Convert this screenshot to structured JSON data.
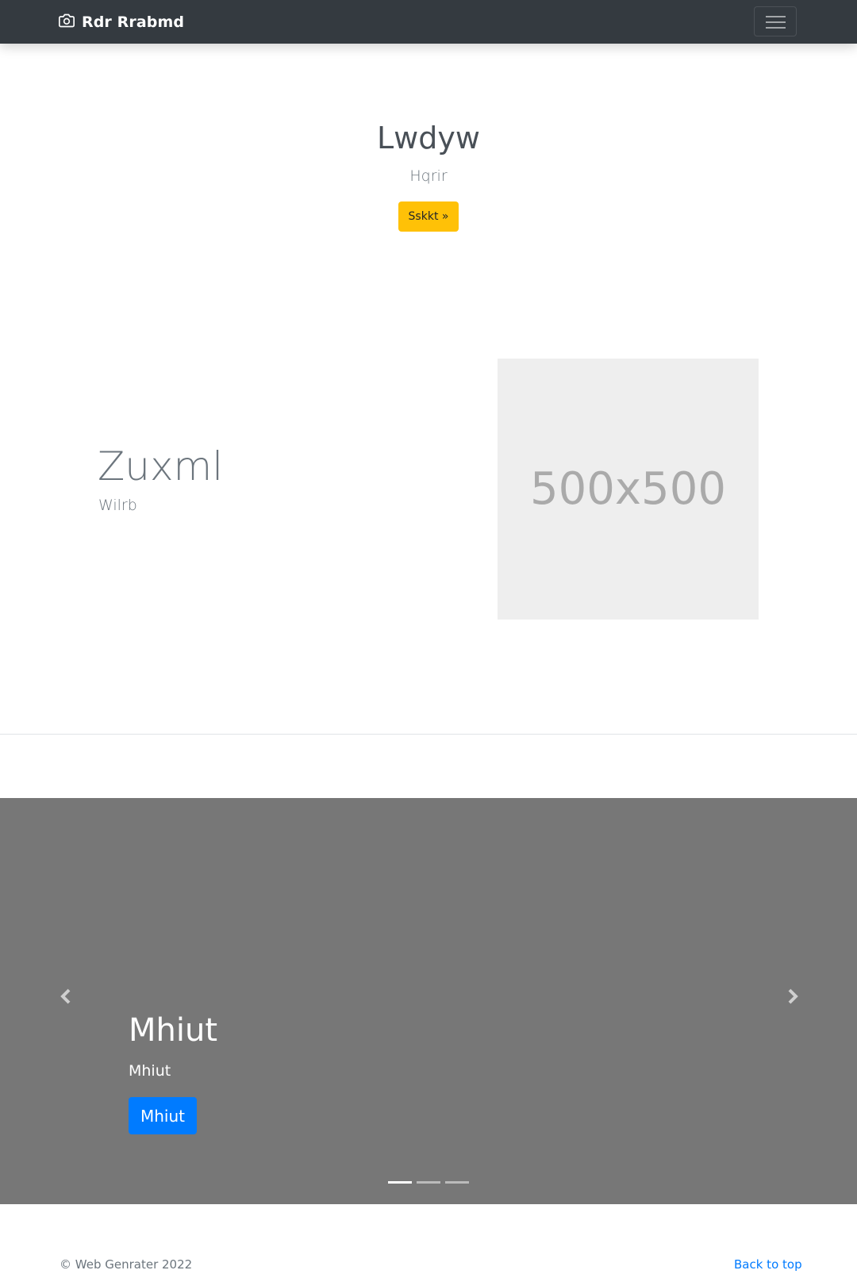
{
  "navbar": {
    "brand_icon": "camera-icon",
    "brand_name": "Rdr Rrabmd",
    "toggler_icon": "hamburger-menu-icon",
    "background_color": "#343a40"
  },
  "hero": {
    "title": "Lwdyw",
    "subtitle": "Hqrir",
    "button_label": "Sskkt »",
    "button_color": "#ffc107"
  },
  "feature": {
    "heading": "Zuxml",
    "lead": "Wilrb",
    "image_label": "500x500"
  },
  "carousel": {
    "prev_icon": "chevron-left-icon",
    "next_icon": "chevron-right-icon",
    "slide_title": "Mhiut",
    "slide_text": "Mhiut",
    "slide_button_label": "Mhiut",
    "slide_button_color": "#007bff",
    "background_color": "#777777",
    "indicator_count": 3,
    "active_indicator": 1
  },
  "footer": {
    "copyright": "© Web Genrater 2022",
    "back_to_top": "Back to top"
  }
}
